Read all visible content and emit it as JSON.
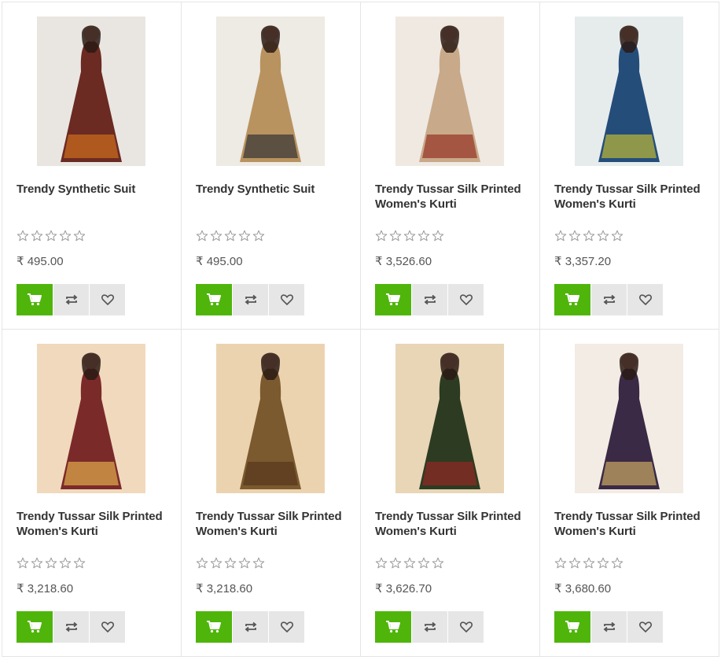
{
  "currency": "₹",
  "colors": {
    "accent": "#4fb50b",
    "secondary_button": "#e6e6e6",
    "border": "#e5e5e5",
    "text": "#333333",
    "star_outline": "#9a9a9a"
  },
  "icons": {
    "cart": "cart-icon",
    "compare": "compare-icon",
    "wishlist": "heart-icon",
    "rating": "star-outline-icon"
  },
  "products": [
    {
      "title": "Trendy Synthetic Suit",
      "price": "495.00",
      "rating": 0,
      "palette": [
        "#6b2a22",
        "#c56a1e",
        "#e9e6e2"
      ]
    },
    {
      "title": "Trendy Synthetic Suit",
      "price": "495.00",
      "rating": 0,
      "palette": [
        "#b8935f",
        "#3c3a38",
        "#eeeae4"
      ]
    },
    {
      "title": "Trendy Tussar Silk Printed Women's Kurti",
      "price": "3,526.60",
      "rating": 0,
      "palette": [
        "#c8a989",
        "#9a3b2c",
        "#efe9e2"
      ]
    },
    {
      "title": "Trendy Tussar Silk Printed Women's Kurti",
      "price": "3,357.20",
      "rating": 0,
      "palette": [
        "#254d7a",
        "#b3b23b",
        "#e6ecec"
      ]
    },
    {
      "title": "Trendy Tussar Silk Printed Women's Kurti",
      "price": "3,218.60",
      "rating": 0,
      "palette": [
        "#7b2a2a",
        "#d9a44a",
        "#f1d9bd"
      ]
    },
    {
      "title": "Trendy Tussar Silk Printed Women's Kurti",
      "price": "3,218.60",
      "rating": 0,
      "palette": [
        "#7a5a2e",
        "#5a3a1e",
        "#ecd3b0"
      ]
    },
    {
      "title": "Trendy Tussar Silk Printed Women's Kurti",
      "price": "3,626.70",
      "rating": 0,
      "palette": [
        "#2d3b22",
        "#8c2a23",
        "#e8d6b6"
      ]
    },
    {
      "title": "Trendy Tussar Silk Printed Women's Kurti",
      "price": "3,680.60",
      "rating": 0,
      "palette": [
        "#3a2a45",
        "#c0a060",
        "#f3ece4"
      ]
    }
  ]
}
